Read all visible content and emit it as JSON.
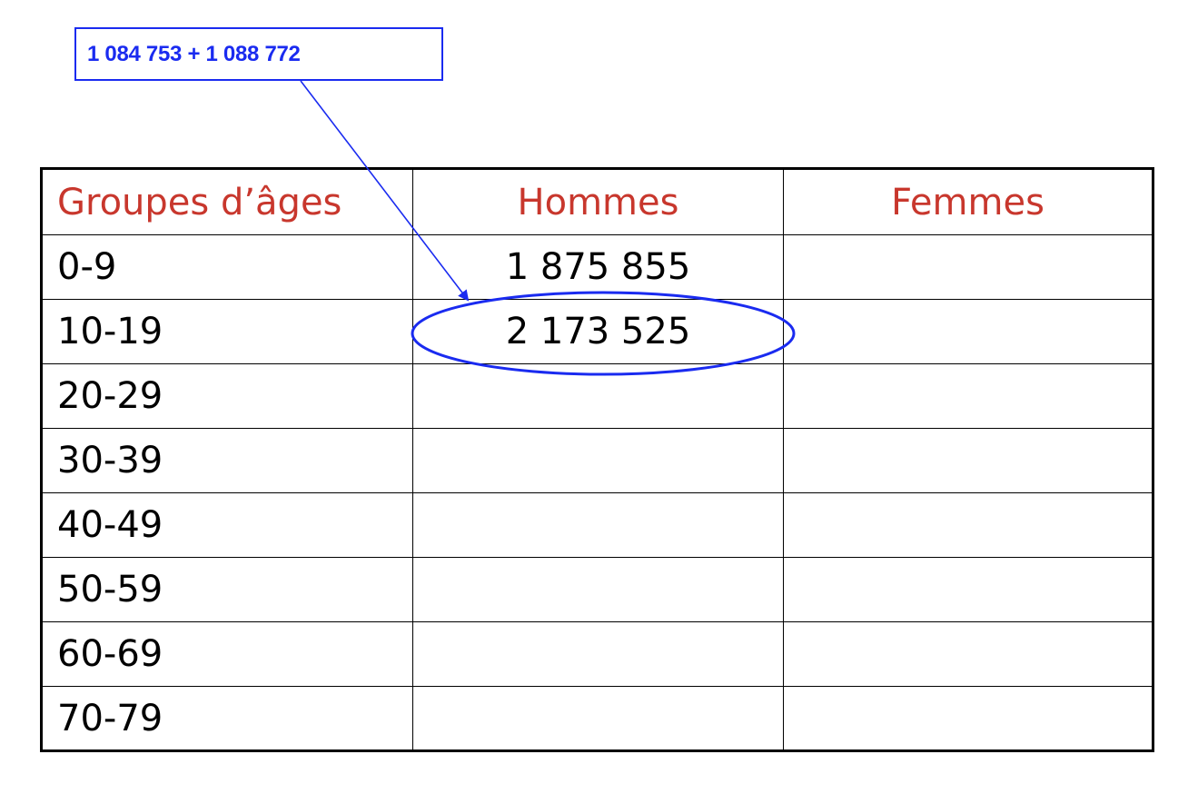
{
  "callout": {
    "text": "1 084 753 + 1 088 772"
  },
  "table": {
    "headers": {
      "age": "Groupes d’âges",
      "hommes": "Hommes",
      "femmes": "Femmes"
    },
    "rows": [
      {
        "age": "0-9",
        "hommes": "1 875 855",
        "femmes": ""
      },
      {
        "age": "10-19",
        "hommes": "2 173 525",
        "femmes": ""
      },
      {
        "age": "20-29",
        "hommes": "",
        "femmes": ""
      },
      {
        "age": "30-39",
        "hommes": "",
        "femmes": ""
      },
      {
        "age": "40-49",
        "hommes": "",
        "femmes": ""
      },
      {
        "age": "50-59",
        "hommes": "",
        "femmes": ""
      },
      {
        "age": "60-69",
        "hommes": "",
        "femmes": ""
      },
      {
        "age": "70-79",
        "hommes": "",
        "femmes": ""
      }
    ]
  },
  "colors": {
    "annotation": "#1a2bf0",
    "header_text": "#c8372d",
    "grid": "#000000"
  }
}
